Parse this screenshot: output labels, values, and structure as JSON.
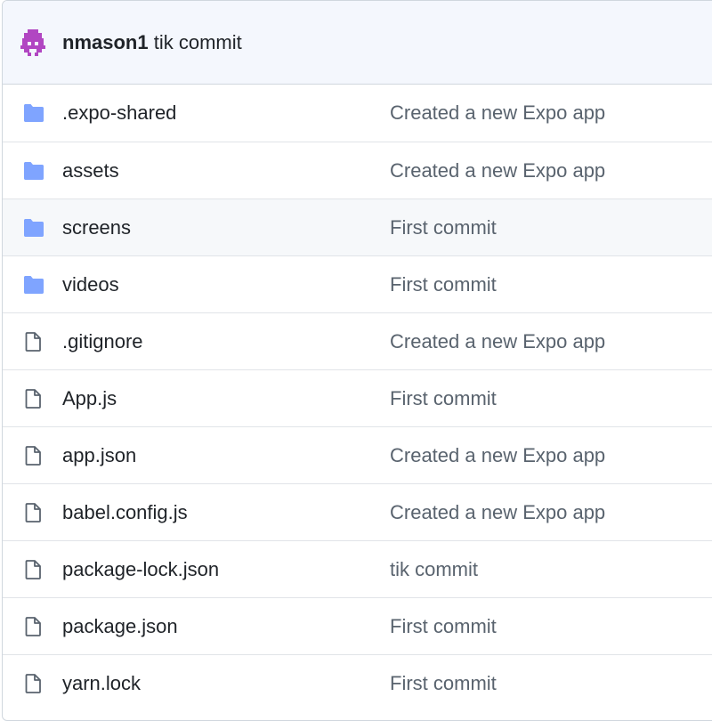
{
  "latest_commit": {
    "author": "nmason1",
    "message": "tik commit"
  },
  "colors": {
    "folder": "#7fa4ff",
    "file_outline": "#59636e",
    "avatar": "#b146c2"
  },
  "files": [
    {
      "name": ".expo-shared",
      "type": "folder",
      "icon": "folder-icon",
      "commit": "Created a new Expo app"
    },
    {
      "name": "assets",
      "type": "folder",
      "icon": "folder-icon",
      "commit": "Created a new Expo app"
    },
    {
      "name": "screens",
      "type": "folder",
      "icon": "folder-icon",
      "commit": "First commit"
    },
    {
      "name": "videos",
      "type": "folder",
      "icon": "folder-icon",
      "commit": "First commit"
    },
    {
      "name": ".gitignore",
      "type": "file",
      "icon": "file-icon",
      "commit": "Created a new Expo app"
    },
    {
      "name": "App.js",
      "type": "file",
      "icon": "file-icon",
      "commit": "First commit"
    },
    {
      "name": "app.json",
      "type": "file",
      "icon": "file-icon",
      "commit": "Created a new Expo app"
    },
    {
      "name": "babel.config.js",
      "type": "file",
      "icon": "file-icon",
      "commit": "Created a new Expo app"
    },
    {
      "name": "package-lock.json",
      "type": "file",
      "icon": "file-icon",
      "commit": "tik commit"
    },
    {
      "name": "package.json",
      "type": "file",
      "icon": "file-icon",
      "commit": "First commit"
    },
    {
      "name": "yarn.lock",
      "type": "file",
      "icon": "file-icon",
      "commit": "First commit"
    }
  ]
}
